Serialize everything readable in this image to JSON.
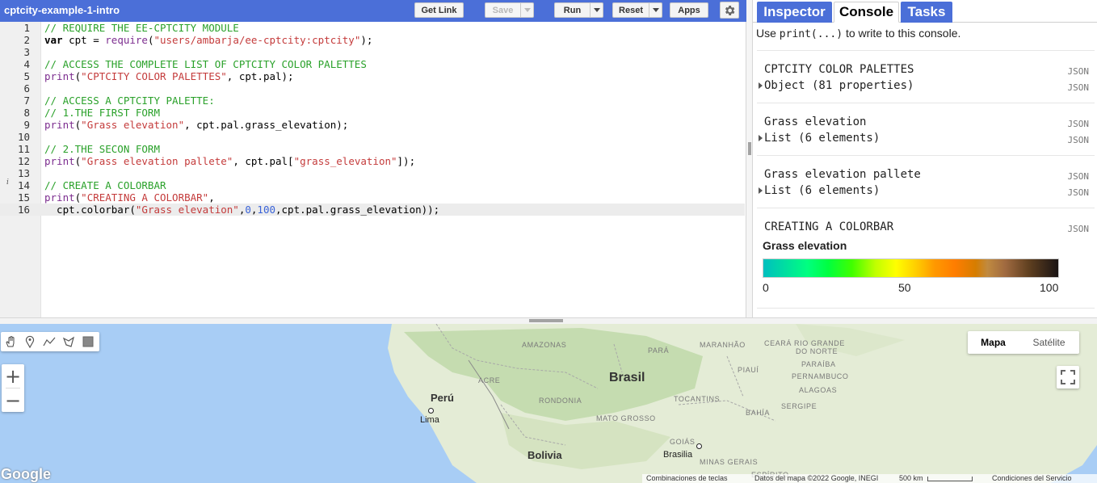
{
  "editor": {
    "script_title": "cptcity-example-1-intro",
    "buttons": {
      "get_link": "Get Link",
      "save": "Save",
      "run": "Run",
      "reset": "Reset",
      "apps": "Apps"
    },
    "icons": {
      "settings": "gear-icon",
      "info_marker": "info-icon"
    },
    "line_numbers": [
      "1",
      "2",
      "3",
      "4",
      "5",
      "6",
      "7",
      "8",
      "9",
      "10",
      "11",
      "12",
      "13",
      "14",
      "15",
      "16"
    ],
    "lines": [
      [
        {
          "t": "cm",
          "v": "// REQUIRE THE EE-CPTCITY MODULE"
        }
      ],
      [
        {
          "t": "kw",
          "v": "var"
        },
        {
          "t": "",
          "v": " cpt = "
        },
        {
          "t": "fn",
          "v": "require"
        },
        {
          "t": "",
          "v": "("
        },
        {
          "t": "st",
          "v": "\"users/ambarja/ee-cptcity:cptcity\""
        },
        {
          "t": "",
          "v": ");"
        }
      ],
      [],
      [
        {
          "t": "cm",
          "v": "// ACCESS THE COMPLETE LIST OF CPTCITY COLOR PALETTES"
        }
      ],
      [
        {
          "t": "fn",
          "v": "print"
        },
        {
          "t": "",
          "v": "("
        },
        {
          "t": "st",
          "v": "\"CPTCITY COLOR PALETTES\""
        },
        {
          "t": "",
          "v": ", cpt.pal);"
        }
      ],
      [],
      [
        {
          "t": "cm",
          "v": "// ACCESS A CPTCITY PALETTE:"
        }
      ],
      [
        {
          "t": "cm",
          "v": "// 1.THE FIRST FORM"
        }
      ],
      [
        {
          "t": "fn",
          "v": "print"
        },
        {
          "t": "",
          "v": "("
        },
        {
          "t": "st",
          "v": "\"Grass elevation\""
        },
        {
          "t": "",
          "v": ", cpt.pal.grass_elevation);"
        }
      ],
      [],
      [
        {
          "t": "cm",
          "v": "// 2.THE SECON FORM"
        }
      ],
      [
        {
          "t": "fn",
          "v": "print"
        },
        {
          "t": "",
          "v": "("
        },
        {
          "t": "st",
          "v": "\"Grass elevation pallete\""
        },
        {
          "t": "",
          "v": ", cpt.pal["
        },
        {
          "t": "st",
          "v": "\"grass_elevation\""
        },
        {
          "t": "",
          "v": "]);"
        }
      ],
      [],
      [
        {
          "t": "cm",
          "v": "// CREATE A COLORBAR"
        }
      ],
      [
        {
          "t": "fn",
          "v": "print"
        },
        {
          "t": "",
          "v": "("
        },
        {
          "t": "st",
          "v": "\"CREATING A COLORBAR\""
        },
        {
          "t": "",
          "v": ","
        }
      ],
      [
        {
          "t": "",
          "v": "  cpt.colorbar("
        },
        {
          "t": "st",
          "v": "\"Grass elevation\""
        },
        {
          "t": "",
          "v": ","
        },
        {
          "t": "nu",
          "v": "0"
        },
        {
          "t": "",
          "v": ","
        },
        {
          "t": "nu",
          "v": "100"
        },
        {
          "t": "",
          "v": ",cpt.pal.grass_elevation));"
        }
      ]
    ],
    "active_line": 16
  },
  "panel": {
    "tabs": [
      "Inspector",
      "Console",
      "Tasks"
    ],
    "active_tab": "Console",
    "hint_prefix": "Use ",
    "hint_code": "print(...)",
    "hint_suffix": " to write to this console.",
    "entries": [
      {
        "title": "CPTCITY COLOR PALETTES",
        "sub": "Object (81 properties)",
        "json": "JSON"
      },
      {
        "title": "Grass elevation",
        "sub": "List (6 elements)",
        "json": "JSON"
      },
      {
        "title": "Grass elevation pallete",
        "sub": "List (6 elements)",
        "json": "JSON"
      },
      {
        "title": "CREATING A COLORBAR",
        "json": "JSON"
      }
    ],
    "colorbar": {
      "label": "Grass elevation",
      "min": "0",
      "mid": "50",
      "max": "100"
    }
  },
  "map": {
    "tool_icons": [
      "hand-icon",
      "marker-icon",
      "line-icon",
      "polygon-icon",
      "rectangle-icon"
    ],
    "zoom_in": "+",
    "zoom_out": "−",
    "map_type": {
      "map": "Mapa",
      "satellite": "Satélite"
    },
    "regions": {
      "amazonas": "AMAZONAS",
      "para": "PARÁ",
      "maranhao": "MARANHÃO",
      "ceara": "CEARÁ",
      "rio_grande": "RIO GRANDE",
      "do_norte": "DO NORTE",
      "paraiba": "PARAÍBA",
      "piaui": "PIAUÍ",
      "pernambuco": "PERNAMBUCO",
      "alagoas": "ALAGOAS",
      "acre": "ACRE",
      "rondonia": "RONDONIA",
      "tocantins": "TOCANTINS",
      "sergipe": "SERGIPE",
      "bahia": "BAHÍA",
      "mato_grosso": "MATO GROSSO",
      "goias": "GOIÁS",
      "minas_gerais": "MINAS GERAIS",
      "espirito": "ESPÍRITO"
    },
    "countries": {
      "brasil": "Brasil",
      "peru": "Perú",
      "bolivia": "Bolivia"
    },
    "cities": {
      "lima": "Lima",
      "brasilia": "Brasilia"
    },
    "logo": "Google",
    "footer": {
      "shortcuts": "Combinaciones de teclas",
      "data": "Datos del mapa ©2022 Google, INEGI",
      "scale": "500 km",
      "terms": "Condiciones del Servicio"
    },
    "colors": {
      "water": "#a8cdf5",
      "land": "#e4ecd6",
      "forest": "#b8d6a0"
    }
  }
}
